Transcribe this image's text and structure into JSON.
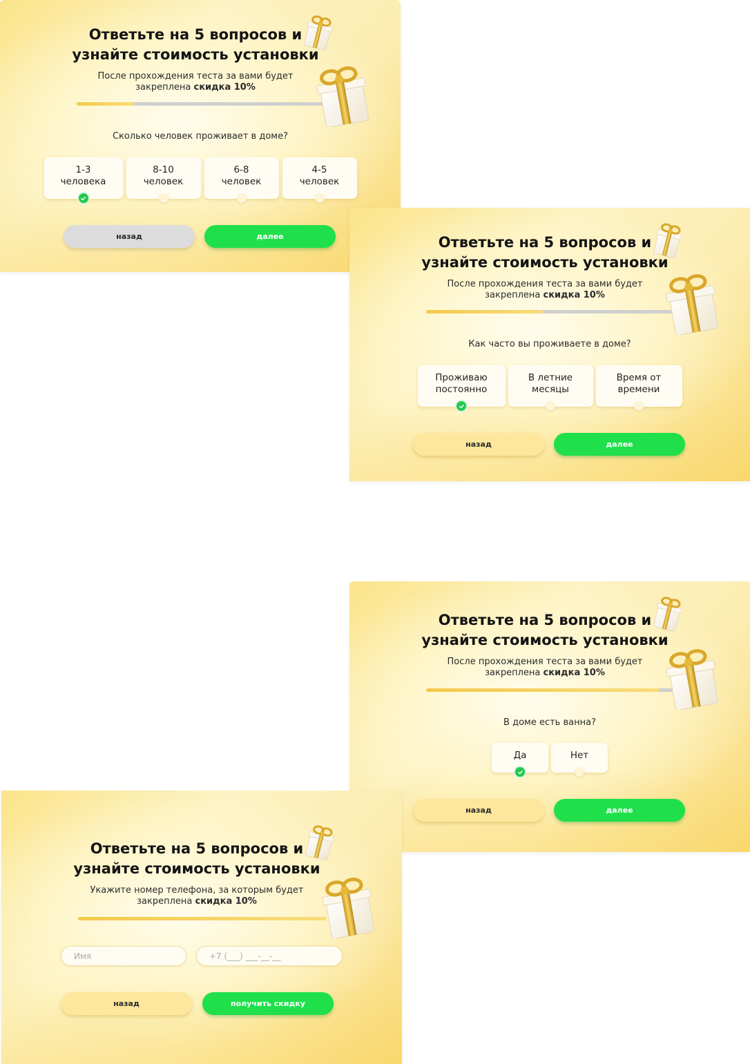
{
  "common": {
    "title_line1": "Ответьте на 5 вопросов и",
    "title_line2": "узнайте стоимость установки",
    "subtitle_line1": "После прохождения теста за вами будет",
    "subtitle_line2_prefix": "закреплена ",
    "subtitle_discount": "скидка 10%",
    "back_label": "назад",
    "next_label": "далее"
  },
  "step1": {
    "progress": 0.23,
    "question": "Сколько человек проживает в доме?",
    "options": [
      {
        "line1": "1-3",
        "line2": "человека",
        "selected": true
      },
      {
        "line1": "8-10",
        "line2": "человек",
        "selected": false
      },
      {
        "line1": "6-8",
        "line2": "человек",
        "selected": false
      },
      {
        "line1": "4-5",
        "line2": "человек",
        "selected": false
      }
    ]
  },
  "step2": {
    "progress": 0.47,
    "question": "Как часто вы проживаете в доме?",
    "options": [
      {
        "line1": "Проживаю",
        "line2": "постоянно",
        "selected": true
      },
      {
        "line1": "В летние",
        "line2": "месяцы",
        "selected": false
      },
      {
        "line1": "Время от",
        "line2": "времени",
        "selected": false
      }
    ]
  },
  "step3": {
    "progress": 0.94,
    "question": "В доме есть ванна?",
    "options": [
      {
        "line1": "Да",
        "selected": true
      },
      {
        "line1": "Нет",
        "selected": false
      }
    ]
  },
  "step4": {
    "progress": 1.0,
    "subtitle_line1": "Укажите номер телефона, за которым будет",
    "name_placeholder": "Имя",
    "phone_placeholder": "+7 (___) ___-__-__",
    "submit_label": "получить скидку"
  },
  "colors": {
    "accent_green": "#1fe04a",
    "progress_gold": "#f3c94a",
    "check_green": "#22c84d"
  },
  "icons": {
    "gift": "gift-icon",
    "check": "check-icon"
  }
}
